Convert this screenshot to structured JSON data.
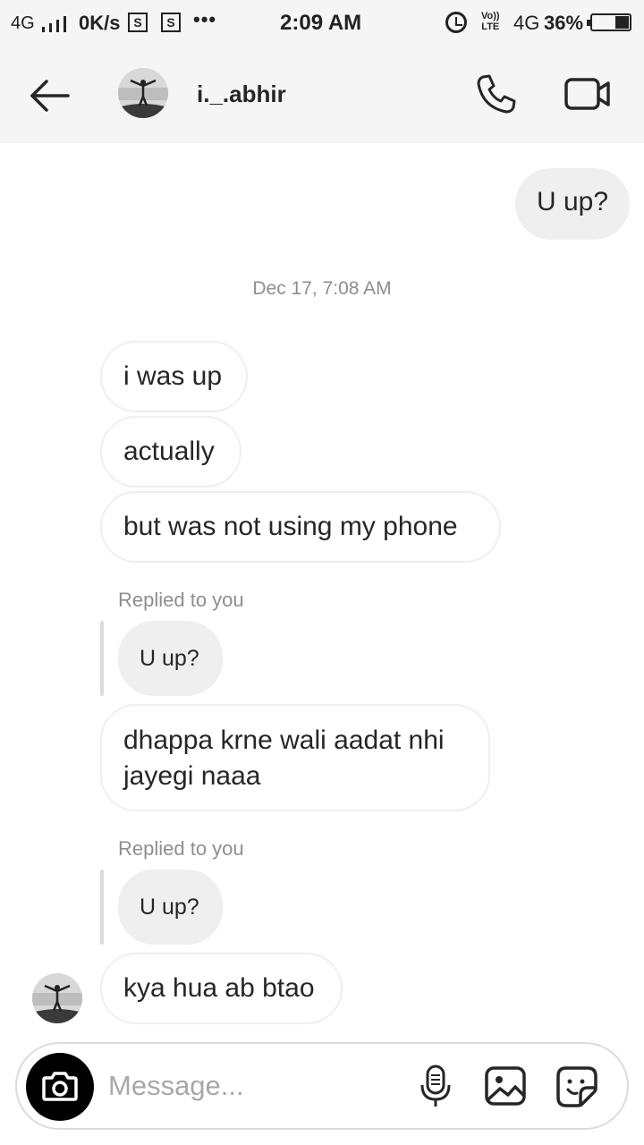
{
  "status_bar": {
    "network": "4G",
    "signal_icon": "signal-bars-icon",
    "speed": "0K/s",
    "sim_badge": "S",
    "more": "•••",
    "time": "2:09 AM",
    "alarm_icon": "alarm-icon",
    "volte_top": "Vo))",
    "volte_bottom": "LTE",
    "data_type": "4G",
    "battery_text": "36%",
    "battery_level": 0.36
  },
  "header": {
    "back_icon": "arrow-left-icon",
    "username": "i._.abhir",
    "call_icon": "phone-icon",
    "video_icon": "video-camera-icon"
  },
  "thread": {
    "sent_message": "U up?",
    "timestamp": "Dec 17, 7:08 AM",
    "messages": [
      "i was up",
      "actually",
      "but was not using my phone"
    ],
    "replies": [
      {
        "label": "Replied to you",
        "quoted": "U up?",
        "lines": [
          "dhappa krne wali aadat nhi",
          "jayegi naaa"
        ]
      },
      {
        "label": "Replied to you",
        "quoted": "U up?",
        "lines": [
          "kya hua ab btao"
        ]
      }
    ]
  },
  "composer": {
    "camera_icon": "camera-icon",
    "placeholder": "Message...",
    "mic_icon": "microphone-icon",
    "gallery_icon": "image-icon",
    "sticker_icon": "sticker-icon"
  },
  "colors": {
    "bar_background": "#f5f5f5",
    "sent_bubble": "#efefef",
    "received_border": "#efefef",
    "meta_text": "#8e8e8e",
    "camera_button": "#000000"
  }
}
